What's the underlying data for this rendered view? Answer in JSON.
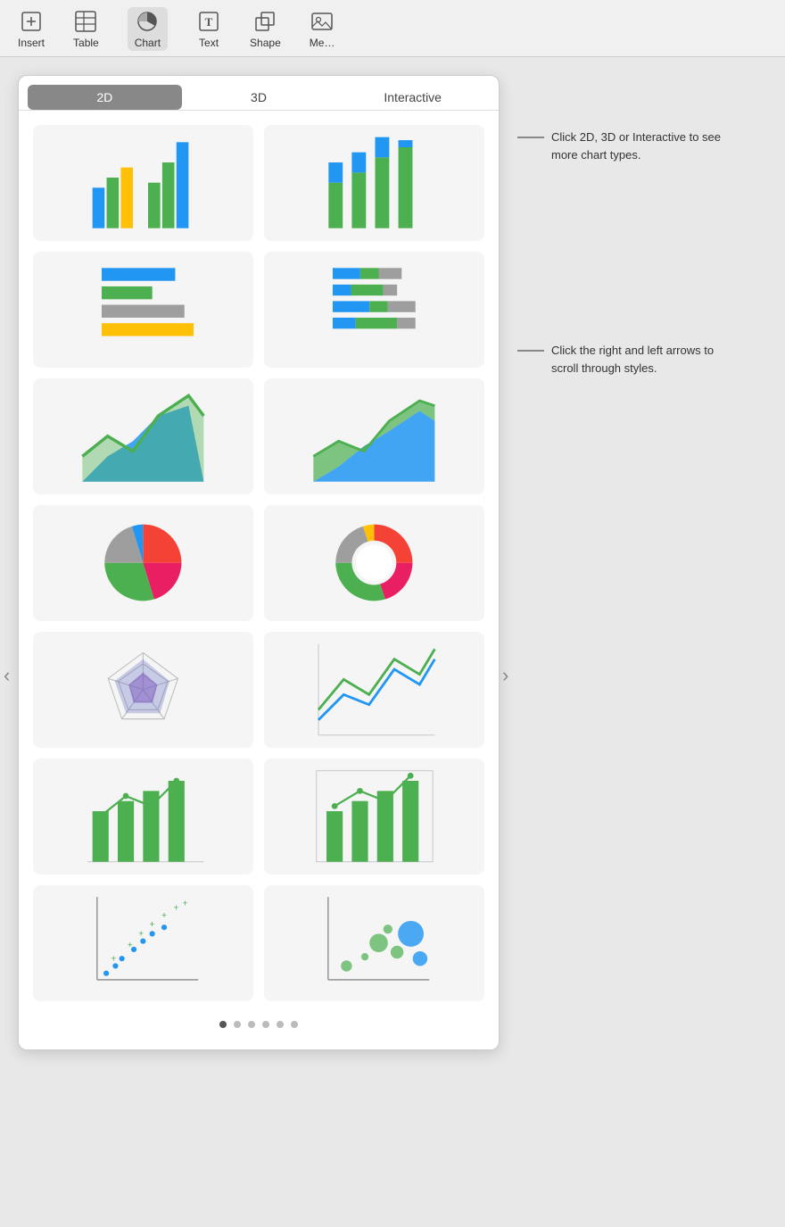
{
  "toolbar": {
    "items": [
      {
        "id": "insert",
        "label": "Insert",
        "icon": "insert"
      },
      {
        "id": "table",
        "label": "Table",
        "icon": "table"
      },
      {
        "id": "chart",
        "label": "Chart",
        "icon": "chart",
        "active": true
      },
      {
        "id": "text",
        "label": "Text",
        "icon": "text"
      },
      {
        "id": "shape",
        "label": "Shape",
        "icon": "shape"
      },
      {
        "id": "media",
        "label": "Me…",
        "icon": "media"
      }
    ]
  },
  "panel": {
    "tabs": [
      {
        "id": "2d",
        "label": "2D",
        "active": true
      },
      {
        "id": "3d",
        "label": "3D",
        "active": false
      },
      {
        "id": "interactive",
        "label": "Interactive",
        "active": false
      }
    ],
    "charts": [
      {
        "id": "grouped-bar",
        "type": "grouped-bar",
        "name": "Grouped Bar Chart"
      },
      {
        "id": "stacked-bar",
        "type": "stacked-bar",
        "name": "Stacked Bar Chart"
      },
      {
        "id": "horizontal-bar",
        "type": "horizontal-bar",
        "name": "Horizontal Bar Chart"
      },
      {
        "id": "stacked-horizontal-bar",
        "type": "stacked-horizontal-bar",
        "name": "Stacked Horizontal Bar Chart"
      },
      {
        "id": "area",
        "type": "area",
        "name": "Area Chart"
      },
      {
        "id": "stacked-area",
        "type": "stacked-area",
        "name": "Stacked Area Chart"
      },
      {
        "id": "pie",
        "type": "pie",
        "name": "Pie Chart"
      },
      {
        "id": "donut",
        "type": "donut",
        "name": "Donut Chart"
      },
      {
        "id": "radar",
        "type": "radar",
        "name": "Radar Chart"
      },
      {
        "id": "line",
        "type": "line",
        "name": "Line Chart"
      },
      {
        "id": "mixed-bar-line",
        "type": "mixed-bar-line",
        "name": "Mixed Bar and Line Chart"
      },
      {
        "id": "mixed-bar-line-box",
        "type": "mixed-bar-line-box",
        "name": "Mixed Bar and Line with Border"
      },
      {
        "id": "scatter",
        "type": "scatter",
        "name": "Scatter Chart"
      },
      {
        "id": "bubble",
        "type": "bubble",
        "name": "Bubble Chart"
      }
    ],
    "pagination": {
      "dots": 6,
      "active_dot": 0
    }
  },
  "annotations": [
    {
      "id": "top-annotation",
      "text": "Click 2D, 3D or Interactive to see more chart types."
    },
    {
      "id": "mid-annotation",
      "text": "Click the right and left arrows to scroll through styles."
    }
  ],
  "nav": {
    "left_arrow": "‹",
    "right_arrow": "›"
  }
}
